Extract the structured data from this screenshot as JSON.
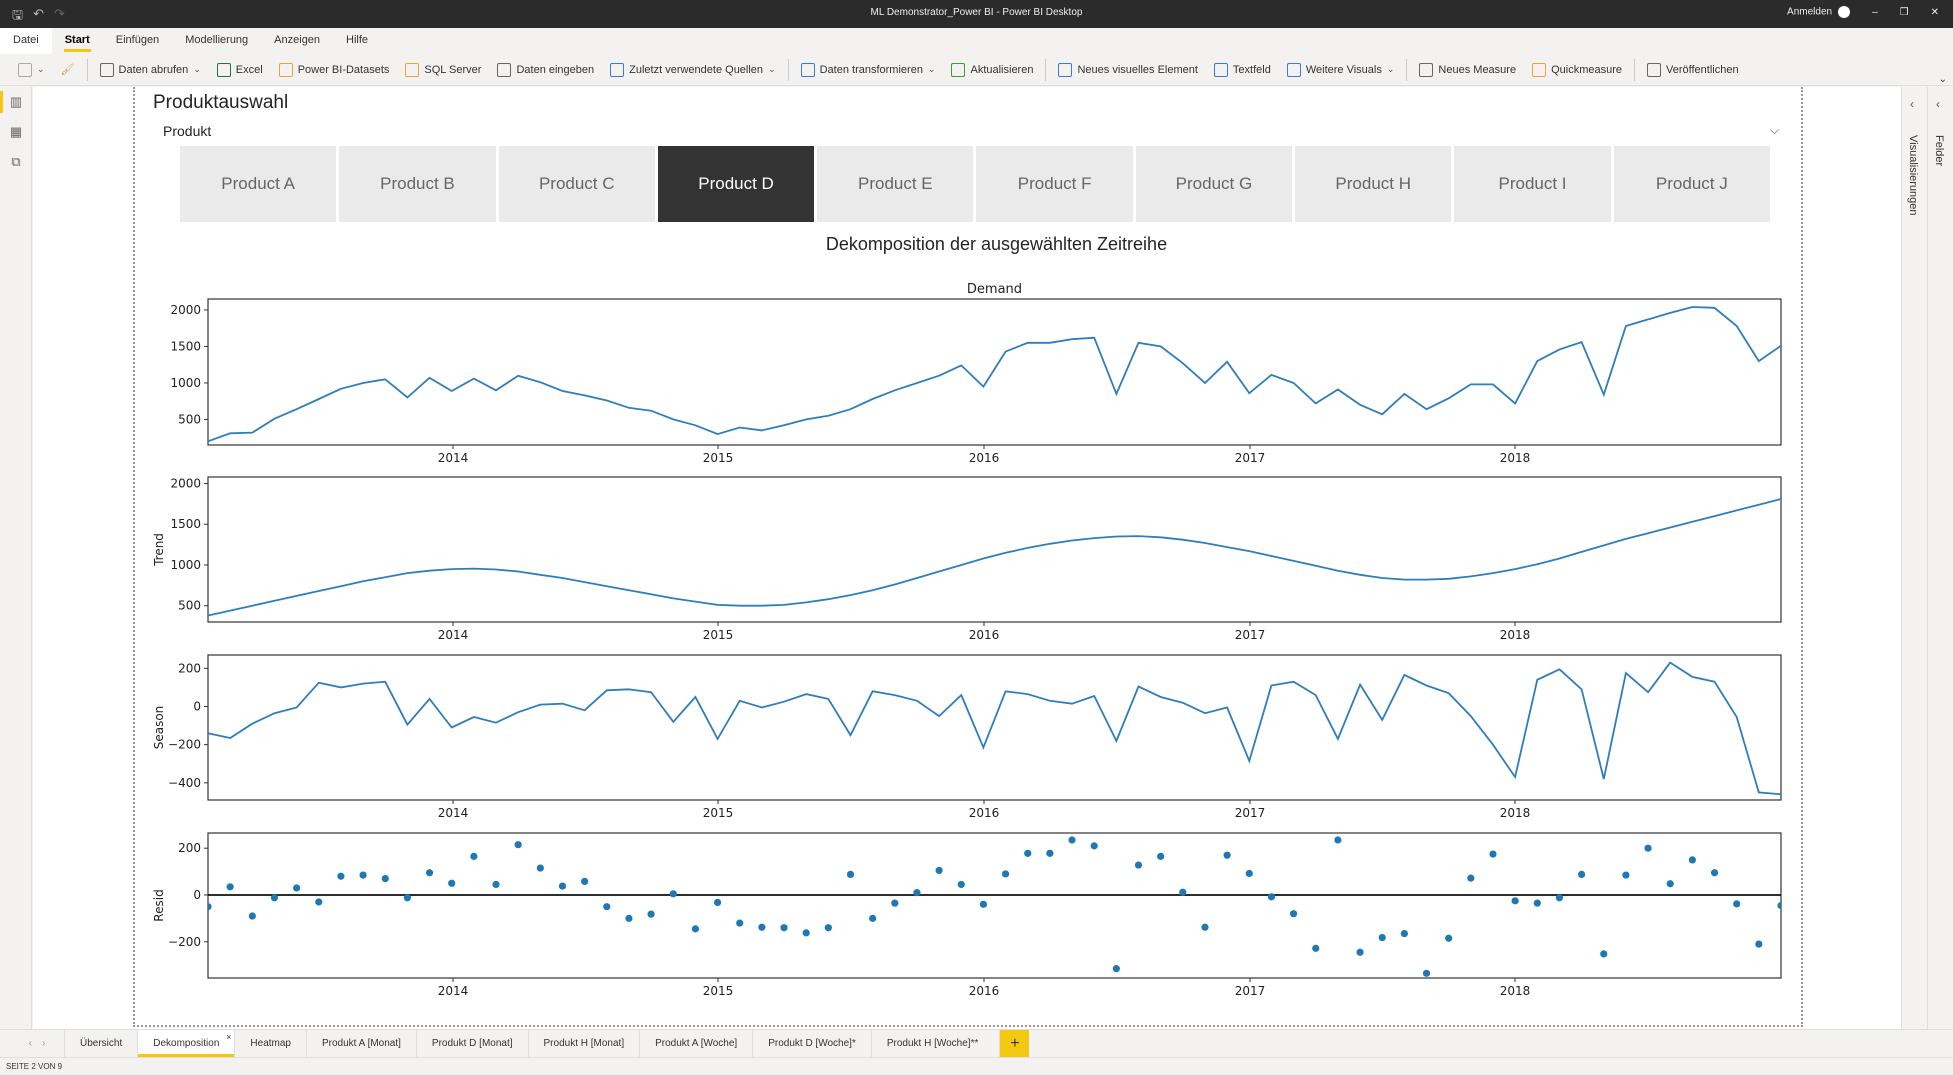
{
  "window": {
    "title": "ML Demonstrator_Power BI - Power BI Desktop",
    "sign_in": "Anmelden",
    "controls": [
      "–",
      "❐",
      "✕"
    ]
  },
  "quick_access": [
    "save-icon",
    "undo-icon",
    "redo-icon"
  ],
  "menu": {
    "items": [
      "Datei",
      "Start",
      "Einfügen",
      "Modellierung",
      "Anzeigen",
      "Hilfe"
    ],
    "active": "Start"
  },
  "ribbon": {
    "items": [
      {
        "label": "Daten abrufen",
        "dropdown": true,
        "icon": "database-icon"
      },
      {
        "label": "Excel",
        "dropdown": false,
        "icon": "excel-icon"
      },
      {
        "label": "Power BI-Datasets",
        "dropdown": false,
        "icon": "dataset-icon"
      },
      {
        "label": "SQL Server",
        "dropdown": false,
        "icon": "sql-server-icon"
      },
      {
        "label": "Daten eingeben",
        "dropdown": false,
        "icon": "table-icon"
      },
      {
        "label": "Zuletzt verwendete Quellen",
        "dropdown": true,
        "icon": "recent-sources-icon"
      },
      {
        "label": "Daten transformieren",
        "dropdown": true,
        "icon": "transform-icon"
      },
      {
        "label": "Aktualisieren",
        "dropdown": false,
        "icon": "refresh-icon"
      },
      {
        "label": "Neues visuelles Element",
        "dropdown": false,
        "icon": "new-visual-icon"
      },
      {
        "label": "Textfeld",
        "dropdown": false,
        "icon": "textbox-icon"
      },
      {
        "label": "Weitere Visuals",
        "dropdown": true,
        "icon": "more-visuals-icon"
      },
      {
        "label": "Neues Measure",
        "dropdown": false,
        "icon": "calculator-icon"
      },
      {
        "label": "Quickmeasure",
        "dropdown": false,
        "icon": "quick-measure-icon"
      },
      {
        "label": "Veröffentlichen",
        "dropdown": false,
        "icon": "publish-icon"
      }
    ]
  },
  "panes": {
    "visualizations": "Visualisierungen",
    "fields": "Felder"
  },
  "slicer": {
    "title": "Produktauswahl",
    "field": "Produkt",
    "options": [
      "Product A",
      "Product B",
      "Product C",
      "Product D",
      "Product E",
      "Product F",
      "Product G",
      "Product H",
      "Product I",
      "Product J"
    ],
    "selected": "Product D"
  },
  "visual": {
    "title": "Dekomposition der ausgewählten Zeitreihe"
  },
  "page_tabs": {
    "tabs": [
      "Übersicht",
      "Dekomposition",
      "Heatmap",
      "Produkt A [Monat]",
      "Produkt D [Monat]",
      "Produkt H [Monat]",
      "Produkt A [Woche]",
      "Produkt D [Woche]*",
      "Produkt H [Woche]**"
    ],
    "active": "Dekomposition",
    "add_label": "+"
  },
  "status": "SEITE 2 VON 9",
  "chart_data": {
    "type": "line",
    "title": "Demand",
    "x_start": "2013-02",
    "x_freq": "monthly",
    "x_ticks": [
      "2014",
      "2015",
      "2016",
      "2017",
      "2018"
    ],
    "line_color": "#2e7ebc",
    "panels": [
      {
        "name": "Demand",
        "ylabel": "",
        "kind": "line",
        "ylim": [
          150,
          2150
        ],
        "yticks": [
          500,
          1000,
          1500,
          2000
        ],
        "values": [
          200,
          310,
          320,
          510,
          640,
          780,
          920,
          1000,
          1050,
          800,
          1070,
          890,
          1060,
          900,
          1100,
          1010,
          890,
          830,
          760,
          660,
          620,
          500,
          420,
          300,
          390,
          350,
          420,
          500,
          550,
          640,
          780,
          900,
          1000,
          1100,
          1240,
          950,
          1430,
          1550,
          1550,
          1600,
          1620,
          850,
          1550,
          1500,
          1270,
          1000,
          1290,
          860,
          1110,
          1000,
          720,
          910,
          700,
          570,
          850,
          640,
          790,
          980,
          980,
          720,
          1300,
          1460,
          1560,
          840,
          1780,
          1870,
          1960,
          2040,
          2030,
          1780,
          1300,
          1510
        ]
      },
      {
        "name": "Trend",
        "ylabel": "Trend",
        "kind": "line",
        "ylim": [
          300,
          2080
        ],
        "yticks": [
          500,
          1000,
          1500,
          2000
        ],
        "values": [
          380,
          440,
          500,
          560,
          620,
          680,
          740,
          800,
          850,
          900,
          930,
          950,
          955,
          945,
          920,
          880,
          840,
          790,
          740,
          690,
          640,
          590,
          550,
          510,
          500,
          500,
          510,
          540,
          580,
          630,
          690,
          760,
          840,
          920,
          1000,
          1080,
          1150,
          1210,
          1260,
          1300,
          1330,
          1350,
          1355,
          1340,
          1310,
          1270,
          1220,
          1170,
          1110,
          1050,
          990,
          930,
          880,
          840,
          820,
          820,
          830,
          860,
          900,
          950,
          1010,
          1080,
          1160,
          1240,
          1320,
          1390,
          1460,
          1530,
          1600,
          1670,
          1740,
          1810
        ]
      },
      {
        "name": "Season",
        "ylabel": "Season",
        "kind": "line",
        "ylim": [
          -490,
          270
        ],
        "yticks": [
          -400,
          -200,
          0,
          200
        ],
        "values": [
          -140,
          -165,
          -90,
          -35,
          -5,
          125,
          100,
          120,
          130,
          -95,
          40,
          -110,
          -55,
          -85,
          -30,
          10,
          15,
          -20,
          85,
          90,
          75,
          -80,
          50,
          -170,
          30,
          -5,
          25,
          65,
          40,
          -150,
          80,
          60,
          30,
          -50,
          60,
          -215,
          80,
          65,
          30,
          15,
          55,
          -180,
          105,
          50,
          20,
          -35,
          -5,
          -285,
          110,
          130,
          60,
          -170,
          115,
          -70,
          165,
          110,
          70,
          -50,
          -200,
          -370,
          140,
          195,
          90,
          -380,
          175,
          75,
          230,
          155,
          130,
          -55,
          -450,
          -460
        ]
      },
      {
        "name": "Resid",
        "ylabel": "Resid",
        "kind": "scatter",
        "ylim": [
          -355,
          265
        ],
        "yticks": [
          -200,
          0,
          200
        ],
        "zero_line": true,
        "values": [
          -50,
          35,
          -90,
          -12,
          30,
          -30,
          80,
          85,
          70,
          -12,
          95,
          50,
          165,
          45,
          215,
          115,
          38,
          58,
          -50,
          -100,
          -82,
          5,
          -145,
          -32,
          -120,
          -138,
          -140,
          -162,
          -140,
          88,
          -100,
          -35,
          10,
          105,
          45,
          -40,
          90,
          178,
          178,
          235,
          210,
          -315,
          128,
          165,
          12,
          -138,
          170,
          92,
          -8,
          -80,
          -228,
          235,
          -245,
          -182,
          -165,
          -335,
          -185,
          72,
          175,
          -25,
          -35,
          -12,
          88,
          -252,
          85,
          200,
          48,
          150,
          95,
          -38,
          -210,
          -45
        ]
      }
    ]
  }
}
